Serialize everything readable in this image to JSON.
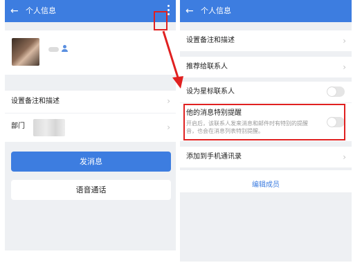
{
  "left_screen": {
    "header": {
      "back_icon": "back-arrow-icon",
      "title": "个人信息",
      "more_icon": "more-vertical-icon"
    },
    "profile": {
      "person_icon": "person-icon"
    },
    "rows": {
      "remark_label": "设置备注和描述",
      "department_label": "部门"
    },
    "buttons": {
      "send_message": "发消息",
      "voice_call": "语音通话"
    }
  },
  "right_screen": {
    "header": {
      "back_icon": "back-arrow-icon",
      "title": "个人信息"
    },
    "rows": {
      "remark_label": "设置备注和描述",
      "recommend_label": "推荐给联系人",
      "star_label": "设为星标联系人",
      "star_enabled": false,
      "reminder_title": "他的消息特别提醒",
      "reminder_desc": "开启后，该联系人发来消息和邮件时有特别的提醒音，也会在消息列表特别提醒。",
      "reminder_enabled": false,
      "add_contacts_label": "添加到手机通讯录",
      "edit_members_label": "编辑成员"
    }
  },
  "annotation": {
    "highlight_color": "#e02020"
  },
  "colors": {
    "accent": "#3d7de0",
    "page_bg": "#eef0f3"
  }
}
